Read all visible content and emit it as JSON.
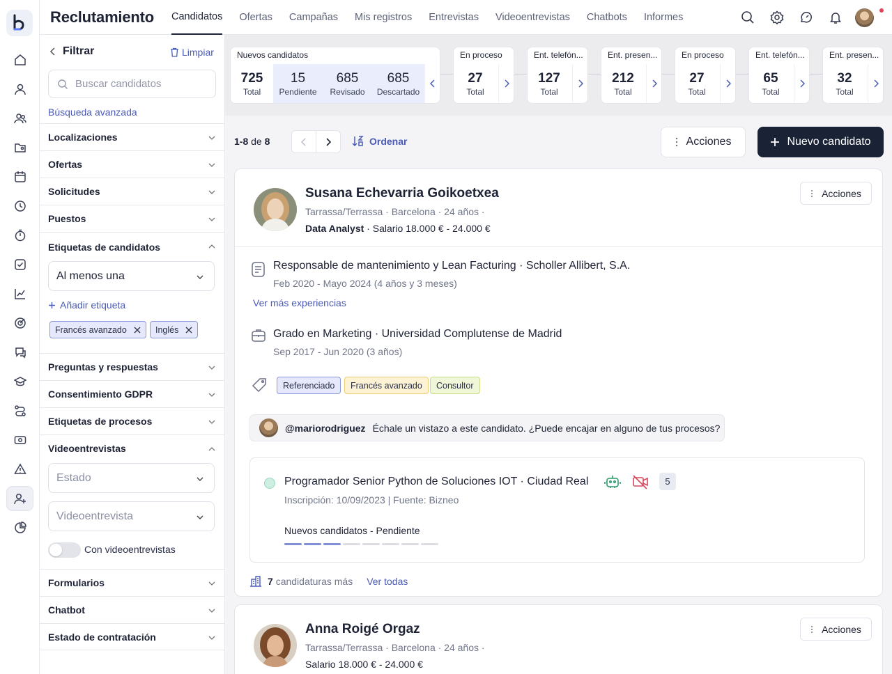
{
  "app": {
    "title": "Reclutamiento"
  },
  "nav": {
    "tabs": [
      "Candidatos",
      "Ofertas",
      "Campañas",
      "Mis registros",
      "Entrevistas",
      "Videoentrevistas",
      "Chatbots",
      "Informes"
    ]
  },
  "filter": {
    "title": "Filtrar",
    "clear_label": "Limpiar",
    "search_placeholder": "Buscar candidatos",
    "advanced_label": "Búsqueda avanzada",
    "sections": {
      "locations": "Localizaciones",
      "offers": "Ofertas",
      "requests": "Solicitudes",
      "positions": "Puestos",
      "candidate_tags": "Etiquetas de candidatos",
      "qa": "Preguntas y respuestas",
      "gdpr": "Consentimiento GDPR",
      "process_tags": "Etiquetas de procesos",
      "video": "Videoentrevistas",
      "forms": "Formularios",
      "chatbot": "Chatbot",
      "hiring": "Estado de contratación"
    },
    "tag_mode": "Al menos una",
    "add_tag_label": "Añadir etiqueta",
    "chips": [
      "Francés avanzado",
      "Inglés"
    ],
    "video_status_placeholder": "Estado",
    "video_select_placeholder": "Videoentrevista",
    "video_toggle_label": "Con videoentrevistas"
  },
  "stages": [
    {
      "title": "Nuevos candidatos",
      "cells": [
        {
          "value": "725",
          "label": "Total"
        },
        {
          "value": "15",
          "label": "Pendiente"
        },
        {
          "value": "685",
          "label": "Revisado"
        },
        {
          "value": "685",
          "label": "Descartado"
        }
      ]
    },
    {
      "title": "En proceso",
      "cells": [
        {
          "value": "27",
          "label": "Total"
        }
      ]
    },
    {
      "title": "Ent. telefón...",
      "cells": [
        {
          "value": "127",
          "label": "Total"
        }
      ]
    },
    {
      "title": "Ent. presen...",
      "cells": [
        {
          "value": "212",
          "label": "Total"
        }
      ]
    },
    {
      "title": "En proceso",
      "cells": [
        {
          "value": "27",
          "label": "Total"
        }
      ]
    },
    {
      "title": "Ent. telefón...",
      "cells": [
        {
          "value": "65",
          "label": "Total"
        }
      ]
    },
    {
      "title": "Ent. presen...",
      "cells": [
        {
          "value": "32",
          "label": "Total"
        }
      ]
    }
  ],
  "toolbar": {
    "range": "1-8",
    "of": "de",
    "total": "8",
    "sort_label": "Ordenar",
    "actions_label": "Acciones",
    "new_label": "Nuevo candidato"
  },
  "candidates": [
    {
      "name": "Susana Echevarria Goikoetxea",
      "location": "Tarrassa/Terrassa · Barcelona · 24 años ·",
      "job": "Data Analyst",
      "salary": " · Salario 18.000 € - 24.000 €",
      "actions_label": "Acciones",
      "experience": {
        "title": "Responsable de mantenimiento y Lean Facturing",
        "company": " · Scholler Allibert, S.A.",
        "dates": "Feb 2020 - Mayo 2024 (4 años y 3 meses)"
      },
      "more_experiences": "Ver más experiencias",
      "education": {
        "title": "Grado en Marketing",
        "school": " · Universidad Complutense de Madrid",
        "dates": "Sep 2017 - Jun 2020 (3 años)"
      },
      "tags": [
        {
          "label": "Referenciado",
          "bg": "#e6e9fb",
          "border": "#8a97d8"
        },
        {
          "label": "Francés avanzado",
          "bg": "#fdf3d4",
          "border": "#e9cf6f"
        },
        {
          "label": "Consultor",
          "bg": "#f0f7d8",
          "border": "#c9dd86"
        }
      ],
      "comment": {
        "user": "@mariorodriguez",
        "text": "Échale un vistazo a este candidato. ¿Puede encajar en alguno de tus procesos?"
      },
      "process": {
        "title": "Programador Senior Python de Soluciones IOT",
        "location": " · Ciudad Real",
        "info": "Inscripción: 10/09/2023 | Fuente: Bizneo",
        "stage": "Nuevos candidatos - Pendiente",
        "count": "5",
        "progress": 3,
        "progress_total": 8
      },
      "more_applications": {
        "count": "7",
        "label": "candidaturas más",
        "link": "Ver todas"
      }
    },
    {
      "name": "Anna Roigé Orgaz",
      "location": "Tarrassa/Terrassa · Barcelona · 24 años ·",
      "salary_line": "Salario 18.000 € - 24.000 €",
      "actions_label": "Acciones"
    }
  ]
}
